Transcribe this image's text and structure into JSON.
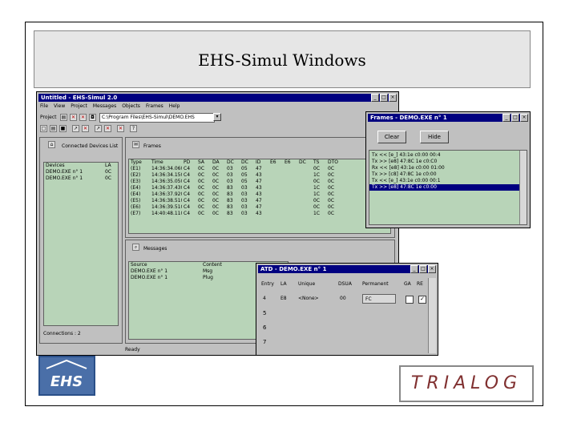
{
  "slide_title": "EHS-Simul Windows",
  "main_window": {
    "title": "Untitled - EHS-Simul 2.0",
    "menu": [
      "File",
      "View",
      "Project",
      "Messages",
      "Objects",
      "Frames",
      "Help"
    ],
    "project_label": "Project",
    "path_value": "C:\\Program Files\\EHS-Simul\\DEMO.EHS",
    "connected_devices": {
      "header": "Connected Devices List",
      "columns": [
        "Devices",
        "LA"
      ],
      "rows": [
        [
          "DEMO.EXE n° 1",
          "0C"
        ],
        [
          "DEMO.EXE n° 1",
          "0C"
        ]
      ],
      "footer": "Connections : 2"
    },
    "frames_grid": {
      "header_label": "Frames",
      "columns": [
        "Type",
        "Time",
        "PD",
        "SA",
        "DA",
        "DC",
        "DC",
        "ID",
        "E6",
        "E6",
        "DC",
        "TS",
        "DTO"
      ],
      "rows": [
        [
          "(E1)",
          "14:36:34.060",
          "C4",
          "0C",
          "0C",
          "03",
          "05",
          "47",
          "",
          "",
          "",
          "0C",
          "0C"
        ],
        [
          "(E2)",
          "14:36:34.150",
          "C4",
          "0C",
          "0C",
          "03",
          "05",
          "43",
          "",
          "",
          "",
          "1C",
          "0C"
        ],
        [
          "(E3)",
          "14:36:35.050",
          "C4",
          "0C",
          "0C",
          "03",
          "05",
          "47",
          "",
          "",
          "",
          "0C",
          "0C"
        ],
        [
          "(E4)",
          "14:36:37.430",
          "C4",
          "0C",
          "0C",
          "83",
          "03",
          "43",
          "",
          "",
          "",
          "1C",
          "0C"
        ],
        [
          "(E4)",
          "14:36:37.920",
          "C4",
          "0C",
          "0C",
          "83",
          "03",
          "43",
          "",
          "",
          "",
          "1C",
          "0C"
        ],
        [
          "(E5)",
          "14:36:38.510",
          "C4",
          "0C",
          "0C",
          "83",
          "03",
          "47",
          "",
          "",
          "",
          "0C",
          "0C"
        ],
        [
          "(E6)",
          "14:36:39.510",
          "C4",
          "0C",
          "0C",
          "83",
          "03",
          "47",
          "",
          "",
          "",
          "0C",
          "0C"
        ],
        [
          "(E7)",
          "14:40:48.110",
          "C4",
          "0C",
          "0C",
          "83",
          "03",
          "43",
          "",
          "",
          "",
          "1C",
          "0C"
        ]
      ]
    },
    "messages": {
      "header_label": "Messages",
      "columns": [
        "Source",
        "Content"
      ],
      "rows": [
        [
          "DEMO.EXE n° 1",
          "Msg"
        ],
        [
          "DEMO.EXE n° 1",
          "Plug"
        ]
      ]
    },
    "status": "Ready"
  },
  "frames_window": {
    "title": "Frames - DEMO.EXE n° 1",
    "clear_label": "Clear",
    "hide_label": "Hide",
    "lines": [
      "Tx << [e_] 43:1e c0:00 00:4",
      "Tx >> [e8] 47:8C 1e c0:C0",
      "Rx << [e8] 43:1e c0:00 01:00",
      "Tx >> [c8] 47:8C 1e c0:00",
      "Tx << [e_] 43:1e c0:00 00:1",
      "Tx >> [e8] 47:8C 1e c0:00"
    ],
    "selected_index": 5
  },
  "atd_window": {
    "title": "ATD - DEMO.EXE n° 1",
    "columns": [
      "Entry",
      "LA",
      "Unique",
      "DSUA",
      "Permanent",
      "GA",
      "RE"
    ],
    "rows": [
      {
        "entry": "4",
        "la": "E8",
        "unique": "<None>",
        "dsua": "00",
        "permanent": "FC"
      },
      {
        "entry": "5"
      },
      {
        "entry": "6"
      },
      {
        "entry": "7"
      }
    ]
  },
  "logos": {
    "ehs": "EHS",
    "trialog": "TRIALOG"
  }
}
